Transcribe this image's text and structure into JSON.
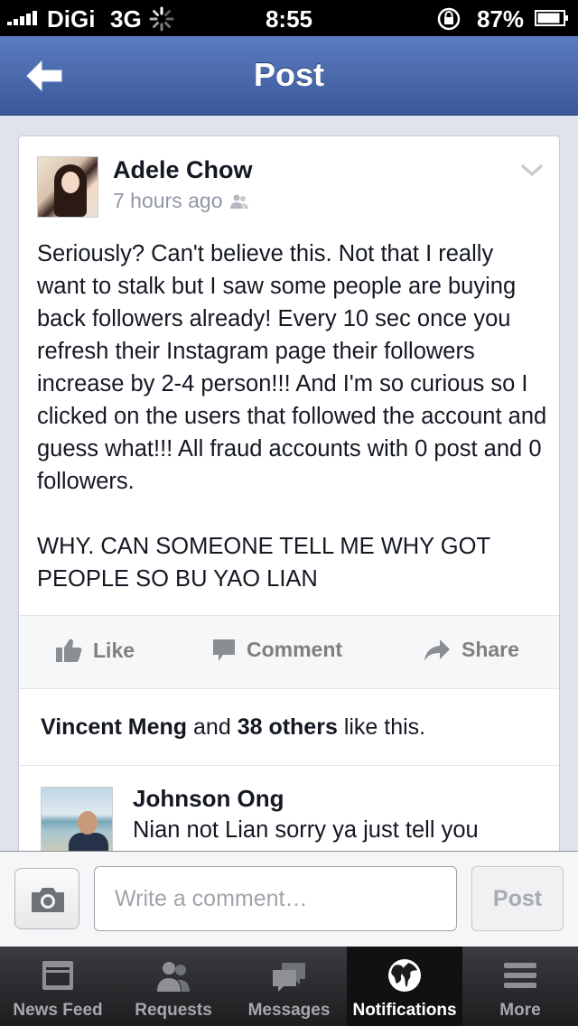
{
  "status_bar": {
    "carrier": "DiGi",
    "network": "3G",
    "time": "8:55",
    "battery_percent": "87%"
  },
  "nav": {
    "title": "Post",
    "back_icon": "back-arrow-icon"
  },
  "post": {
    "author": "Adele Chow",
    "timestamp": "7 hours ago",
    "audience_icon": "friends-icon",
    "body": "Seriously? Can't believe this. Not that I really want to stalk but I saw some people are buying back followers already! Every 10 sec once you refresh their Instagram page their followers increase by 2-4 person!!! And I'm so curious so I clicked on the users that followed the account and guess what!!! All fraud accounts with 0 post and 0 followers.\n\nWHY. CAN SOMEONE TELL ME WHY GOT PEOPLE SO BU YAO LIAN",
    "actions": {
      "like": "Like",
      "comment": "Comment",
      "share": "Share"
    },
    "likes": {
      "name": "Vincent Meng",
      "and": "and",
      "others": "38 others",
      "suffix": "like this."
    }
  },
  "comment": {
    "author": "Johnson Ong",
    "text": "Nian not Lian sorry ya just tell you"
  },
  "composer": {
    "placeholder": "Write a comment…",
    "post_label": "Post",
    "camera_icon": "camera-icon"
  },
  "tabs": [
    {
      "label": "News Feed",
      "icon": "news-feed-icon",
      "active": false
    },
    {
      "label": "Requests",
      "icon": "requests-icon",
      "active": false
    },
    {
      "label": "Messages",
      "icon": "messages-icon",
      "active": false
    },
    {
      "label": "Notifications",
      "icon": "globe-icon",
      "active": true
    },
    {
      "label": "More",
      "icon": "menu-icon",
      "active": false
    }
  ],
  "colors": {
    "brand_blue": "#3b5998",
    "background": "#dfe3ee",
    "action_gray": "#7f7f7f"
  }
}
